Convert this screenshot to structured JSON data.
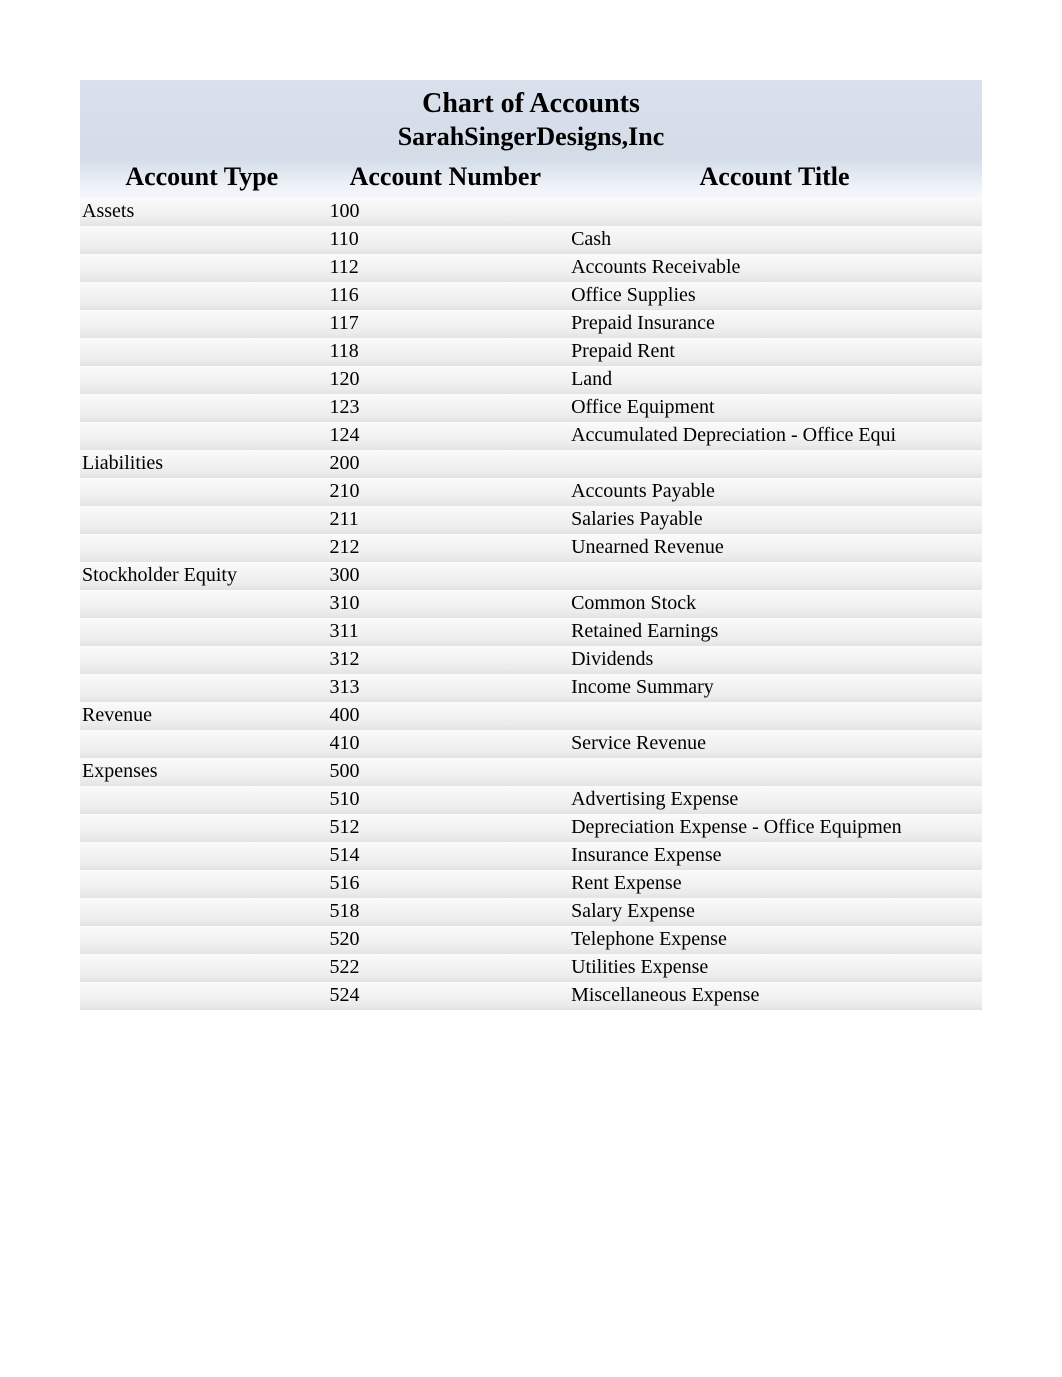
{
  "header": {
    "title": "Chart of Accounts",
    "company": "SarahSingerDesigns,Inc"
  },
  "columns": {
    "type": "Account Type",
    "number": "Account Number",
    "title": "Account Title"
  },
  "rows": [
    {
      "type": "Assets",
      "number": "100",
      "title": ""
    },
    {
      "type": "",
      "number": "110",
      "title": "Cash"
    },
    {
      "type": "",
      "number": "112",
      "title": "Accounts Receivable"
    },
    {
      "type": "",
      "number": "116",
      "title": "Office Supplies"
    },
    {
      "type": "",
      "number": "117",
      "title": "Prepaid Insurance"
    },
    {
      "type": "",
      "number": "118",
      "title": "Prepaid Rent"
    },
    {
      "type": "",
      "number": "120",
      "title": "Land"
    },
    {
      "type": "",
      "number": "123",
      "title": "Office Equipment"
    },
    {
      "type": "",
      "number": "124",
      "title": "Accumulated Depreciation - Office Equi"
    },
    {
      "type": "Liabilities",
      "number": "200",
      "title": ""
    },
    {
      "type": "",
      "number": "210",
      "title": "Accounts Payable"
    },
    {
      "type": "",
      "number": "211",
      "title": "Salaries Payable"
    },
    {
      "type": "",
      "number": "212",
      "title": "Unearned Revenue"
    },
    {
      "type": "Stockholder Equity",
      "number": "300",
      "title": ""
    },
    {
      "type": "",
      "number": "310",
      "title": "Common Stock"
    },
    {
      "type": "",
      "number": "311",
      "title": "Retained Earnings"
    },
    {
      "type": "",
      "number": "312",
      "title": "Dividends"
    },
    {
      "type": "",
      "number": "313",
      "title": "Income Summary"
    },
    {
      "type": "Revenue",
      "number": "400",
      "title": ""
    },
    {
      "type": "",
      "number": "410",
      "title": "Service Revenue"
    },
    {
      "type": "Expenses",
      "number": "500",
      "title": ""
    },
    {
      "type": "",
      "number": "510",
      "title": "Advertising Expense"
    },
    {
      "type": "",
      "number": "512",
      "title": "Depreciation Expense - Office Equipmen"
    },
    {
      "type": "",
      "number": "514",
      "title": "Insurance Expense"
    },
    {
      "type": "",
      "number": "516",
      "title": "Rent Expense"
    },
    {
      "type": "",
      "number": "518",
      "title": "Salary Expense"
    },
    {
      "type": "",
      "number": "520",
      "title": "Telephone Expense"
    },
    {
      "type": "",
      "number": "522",
      "title": "Utilities Expense"
    },
    {
      "type": "",
      "number": "524",
      "title": "Miscellaneous Expense"
    }
  ],
  "chart_data": {
    "type": "table",
    "title": "Chart of Accounts — SarahSingerDesigns,Inc",
    "columns": [
      "Account Type",
      "Account Number",
      "Account Title"
    ],
    "rows": [
      [
        "Assets",
        "100",
        ""
      ],
      [
        "",
        "110",
        "Cash"
      ],
      [
        "",
        "112",
        "Accounts Receivable"
      ],
      [
        "",
        "116",
        "Office Supplies"
      ],
      [
        "",
        "117",
        "Prepaid Insurance"
      ],
      [
        "",
        "118",
        "Prepaid Rent"
      ],
      [
        "",
        "120",
        "Land"
      ],
      [
        "",
        "123",
        "Office Equipment"
      ],
      [
        "",
        "124",
        "Accumulated Depreciation - Office Equi"
      ],
      [
        "Liabilities",
        "200",
        ""
      ],
      [
        "",
        "210",
        "Accounts Payable"
      ],
      [
        "",
        "211",
        "Salaries Payable"
      ],
      [
        "",
        "212",
        "Unearned Revenue"
      ],
      [
        "Stockholder Equity",
        "300",
        ""
      ],
      [
        "",
        "310",
        "Common Stock"
      ],
      [
        "",
        "311",
        "Retained Earnings"
      ],
      [
        "",
        "312",
        "Dividends"
      ],
      [
        "",
        "313",
        "Income Summary"
      ],
      [
        "Revenue",
        "400",
        ""
      ],
      [
        "",
        "410",
        "Service Revenue"
      ],
      [
        "Expenses",
        "500",
        ""
      ],
      [
        "",
        "510",
        "Advertising Expense"
      ],
      [
        "",
        "512",
        "Depreciation Expense - Office Equipmen"
      ],
      [
        "",
        "514",
        "Insurance Expense"
      ],
      [
        "",
        "516",
        "Rent Expense"
      ],
      [
        "",
        "518",
        "Salary Expense"
      ],
      [
        "",
        "520",
        "Telephone Expense"
      ],
      [
        "",
        "522",
        "Utilities Expense"
      ],
      [
        "",
        "524",
        "Miscellaneous Expense"
      ]
    ]
  }
}
